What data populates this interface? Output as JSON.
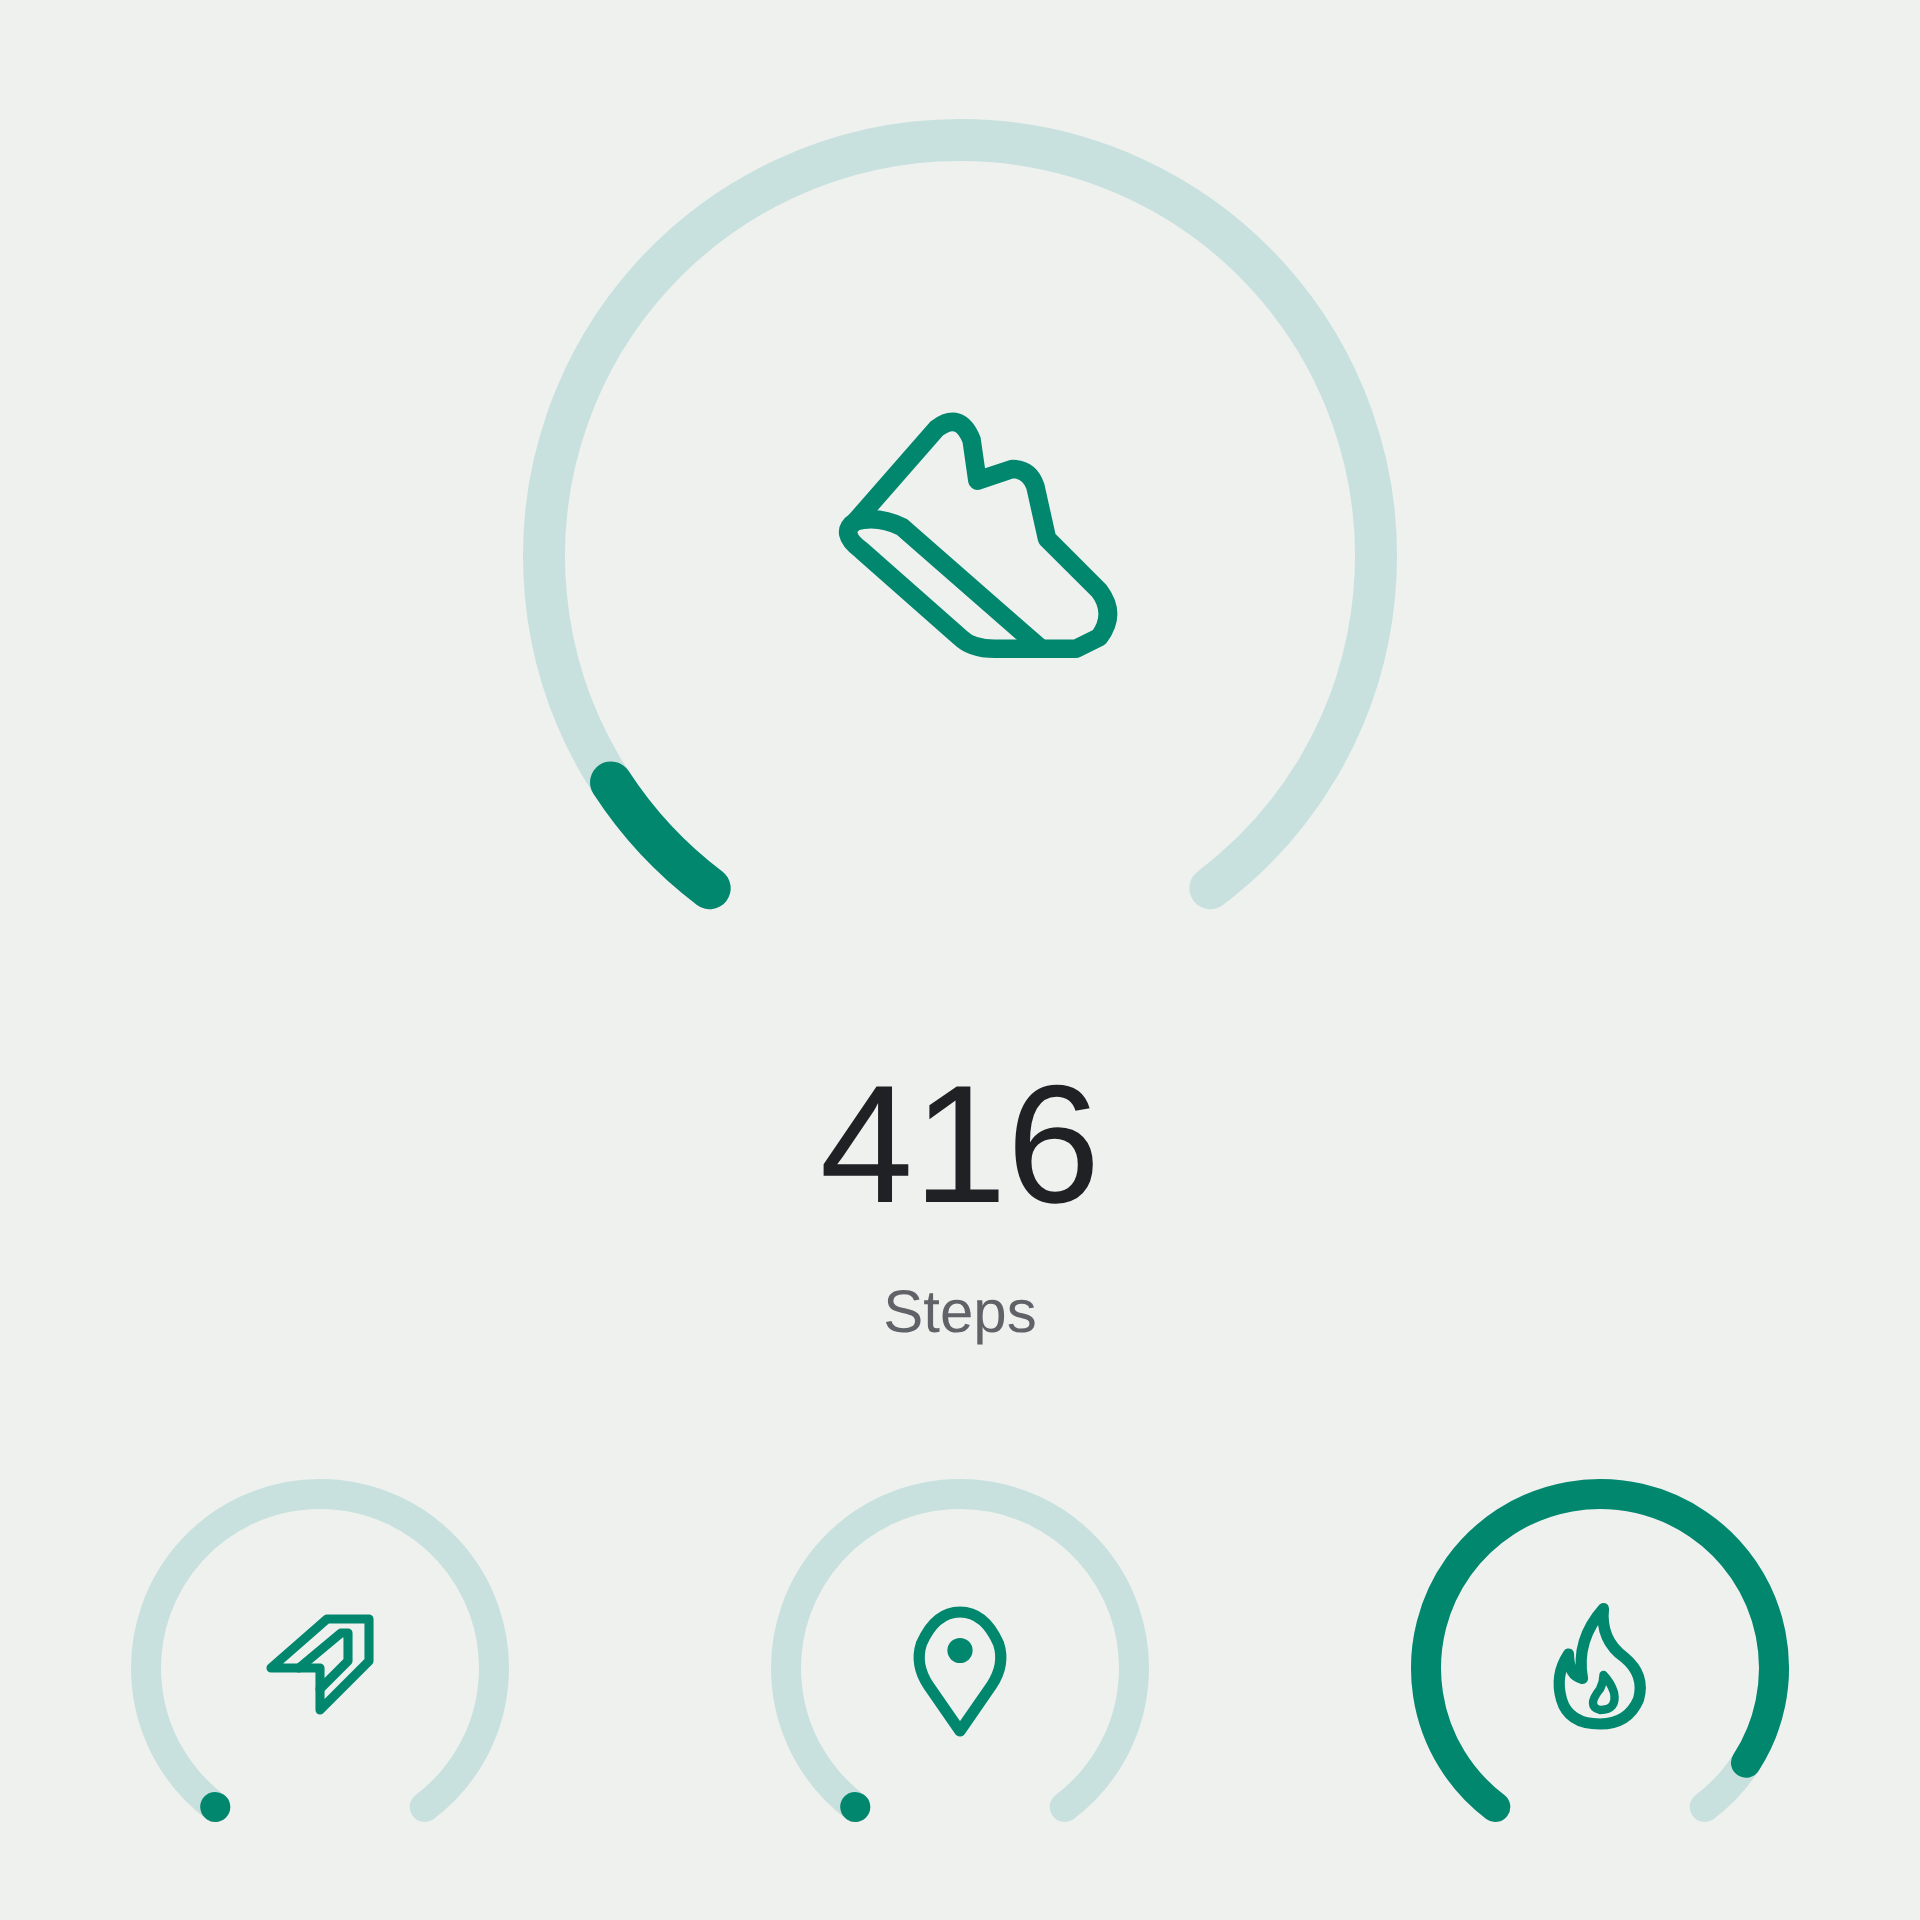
{
  "main_gauge": {
    "kind": "gauge",
    "value": "416",
    "label": "Steps"
  },
  "small_gauges": [
    {
      "kind": "gauge"
    },
    {
      "kind": "gauge"
    },
    {
      "kind": "gauge"
    }
  ]
}
